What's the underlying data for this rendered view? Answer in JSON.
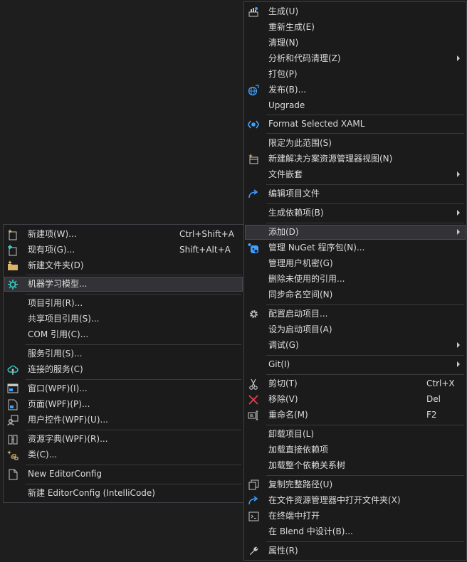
{
  "main_menu": {
    "items": [
      {
        "label": "生成(U)",
        "icon": "build-icon"
      },
      {
        "label": "重新生成(E)"
      },
      {
        "label": "清理(N)"
      },
      {
        "label": "分析和代码清理(Z)",
        "submenu": true
      },
      {
        "label": "打包(P)"
      },
      {
        "label": "发布(B)...",
        "icon": "publish-globe-icon"
      },
      {
        "label": "Upgrade"
      },
      {
        "label": "Format Selected XAML",
        "icon": "format-xaml-icon"
      },
      {
        "label": "限定为此范围(S)"
      },
      {
        "label": "新建解决方案资源管理器视图(N)",
        "icon": "new-view-icon"
      },
      {
        "label": "文件嵌套",
        "submenu": true
      },
      {
        "label": "编辑项目文件",
        "icon": "edit-redo-icon"
      },
      {
        "label": "生成依赖项(B)",
        "submenu": true
      },
      {
        "label": "添加(D)",
        "submenu": true
      },
      {
        "label": "管理 NuGet 程序包(N)...",
        "icon": "nuget-icon"
      },
      {
        "label": "管理用户机密(G)"
      },
      {
        "label": "删除未使用的引用..."
      },
      {
        "label": "同步命名空间(N)"
      },
      {
        "label": "配置启动项目...",
        "icon": "gear-icon"
      },
      {
        "label": "设为启动项目(A)"
      },
      {
        "label": "调试(G)",
        "submenu": true
      },
      {
        "label": "Git(I)",
        "submenu": true
      },
      {
        "label": "剪切(T)",
        "shortcut": "Ctrl+X",
        "icon": "scissors-icon"
      },
      {
        "label": "移除(V)",
        "shortcut": "Del",
        "icon": "remove-x-icon"
      },
      {
        "label": "重命名(M)",
        "shortcut": "F2",
        "icon": "rename-icon"
      },
      {
        "label": "卸载项目(L)"
      },
      {
        "label": "加载直接依赖项"
      },
      {
        "label": "加载整个依赖关系树"
      },
      {
        "label": "复制完整路径(U)",
        "icon": "copy-icon"
      },
      {
        "label": "在文件资源管理器中打开文件夹(X)",
        "icon": "open-folder-arrow-icon"
      },
      {
        "label": "在终端中打开",
        "icon": "terminal-icon"
      },
      {
        "label": "在 Blend 中设计(B)..."
      },
      {
        "label": "属性(R)",
        "icon": "wrench-icon"
      }
    ]
  },
  "sub_menu": {
    "items": [
      {
        "label": "新建项(W)...",
        "shortcut": "Ctrl+Shift+A",
        "icon": "new-item-icon"
      },
      {
        "label": "现有项(G)...",
        "shortcut": "Shift+Alt+A",
        "icon": "existing-item-icon"
      },
      {
        "label": "新建文件夹(D)",
        "icon": "new-folder-icon"
      },
      {
        "label": "机器学习模型...",
        "icon": "ml-model-icon"
      },
      {
        "label": "项目引用(R)..."
      },
      {
        "label": "共享项目引用(S)..."
      },
      {
        "label": "COM 引用(C)..."
      },
      {
        "label": "服务引用(S)..."
      },
      {
        "label": "连接的服务(C)",
        "icon": "connected-service-icon"
      },
      {
        "label": "窗口(WPF)(I)...",
        "icon": "window-icon"
      },
      {
        "label": "页面(WPF)(P)...",
        "icon": "page-icon"
      },
      {
        "label": "用户控件(WPF)(U)...",
        "icon": "user-control-icon"
      },
      {
        "label": "资源字典(WPF)(R)...",
        "icon": "resource-dictionary-icon"
      },
      {
        "label": "类(C)...",
        "icon": "class-icon"
      },
      {
        "label": "New EditorConfig",
        "icon": "editorconfig-file-icon"
      },
      {
        "label": "新建 EditorConfig (IntelliCode)"
      }
    ]
  },
  "colors": {
    "background": "#1e1e1e",
    "menu_bg": "#1b1b1c",
    "menu_border": "#3f3f46",
    "highlight": "#333337",
    "text": "#dcdcdc",
    "accent_blue": "#3ea0ff"
  }
}
